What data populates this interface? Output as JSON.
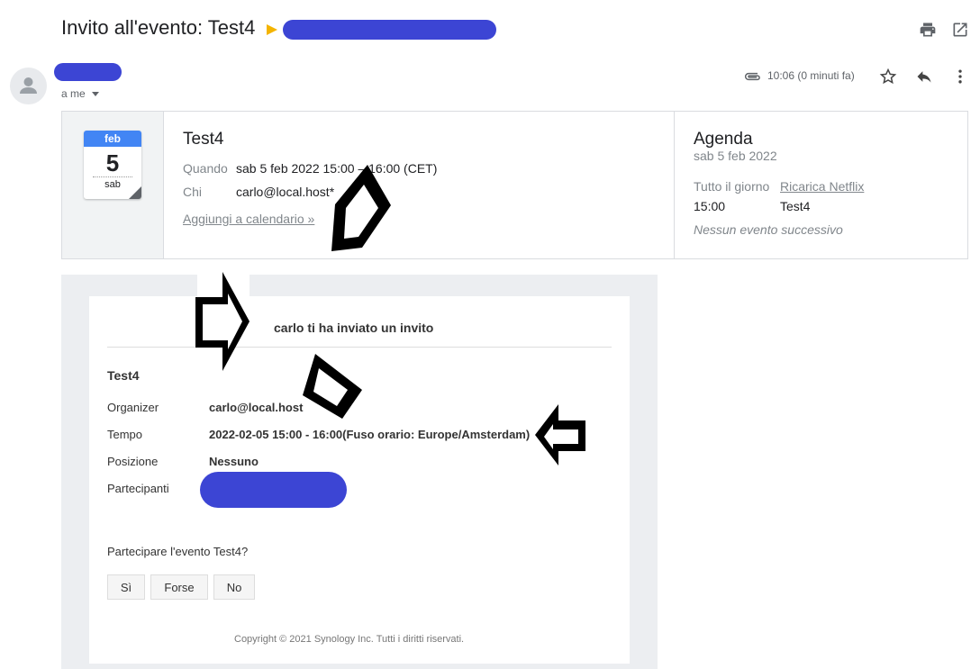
{
  "header": {
    "subject": "Invito all'evento: Test4",
    "print_icon": "print-icon",
    "open_icon": "open-in-new-icon"
  },
  "message": {
    "recipient_label": "a me",
    "time": "10:06 (0 minuti fa)",
    "attachment_icon": "paperclip-icon"
  },
  "event_card": {
    "calendar_icon": {
      "month": "feb",
      "day": "5",
      "weekday": "sab"
    },
    "title": "Test4",
    "when_label": "Quando",
    "when_value": "sab 5 feb 2022 15:00 – 16:00 (CET)",
    "who_label": "Chi",
    "who_value": "carlo@local.host*",
    "add_link": "Aggiungi a calendario »"
  },
  "agenda": {
    "title": "Agenda",
    "date": "sab 5 feb 2022",
    "allday_label": "Tutto il giorno",
    "allday_event": "Ricarica Netflix",
    "time": "15:00",
    "time_event": "Test4",
    "none": "Nessun evento successivo"
  },
  "invite": {
    "header": "carlo ti ha inviato un invito",
    "title": "Test4",
    "rows": [
      {
        "label": "Organizer",
        "value": "carlo@local.host"
      },
      {
        "label": "Tempo",
        "value": "2022-02-05 15:00 - 16:00(Fuso orario: Europe/Amsterdam)"
      },
      {
        "label": "Posizione",
        "value": "Nessuno"
      },
      {
        "label": "Partecipanti",
        "value": ""
      }
    ],
    "question": "Partecipare l'evento Test4?",
    "buttons": {
      "yes": "Sì",
      "maybe": "Forse",
      "no": "No"
    },
    "copyright": "Copyright © 2021 Synology Inc. Tutti i diritti riservati."
  },
  "colors": {
    "redaction": "#3c45d4",
    "calendar_blue": "#4285f4",
    "label_yellow": "#f4b400"
  }
}
